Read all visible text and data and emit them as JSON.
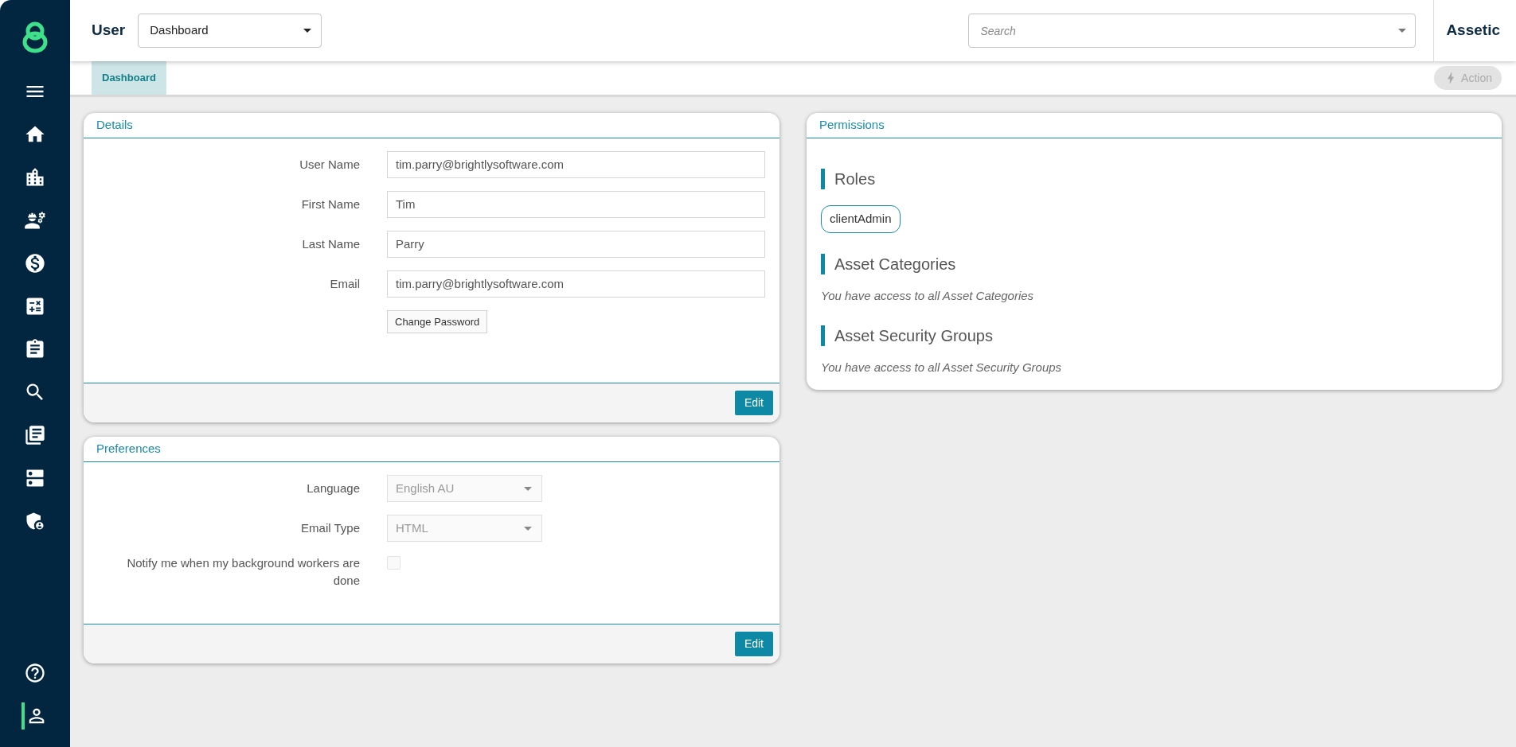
{
  "header": {
    "title": "User",
    "view_select": {
      "value": "Dashboard"
    },
    "search": {
      "placeholder": "Search"
    },
    "brand": "Assetic"
  },
  "tabs": [
    {
      "label": "Dashboard",
      "selected": true
    }
  ],
  "action_button": {
    "label": "Action",
    "disabled": true
  },
  "sidebar": {
    "items": [
      {
        "selected": false
      },
      {
        "selected": false
      },
      {
        "selected": false
      },
      {
        "selected": false
      },
      {
        "selected": false
      },
      {
        "selected": false
      },
      {
        "selected": false
      },
      {
        "selected": false
      },
      {
        "selected": false
      },
      {
        "selected": false
      },
      {
        "selected": false
      }
    ],
    "bottom_items": [
      {
        "selected": false
      },
      {
        "selected": true
      }
    ]
  },
  "details": {
    "title": "Details",
    "fields": [
      {
        "label": "User Name",
        "value": "tim.parry@brightlysoftware.com"
      },
      {
        "label": "First Name",
        "value": "Tim"
      },
      {
        "label": "Last Name",
        "value": "Parry"
      },
      {
        "label": "Email",
        "value": "tim.parry@brightlysoftware.com"
      }
    ],
    "change_password": "Change Password",
    "edit": "Edit"
  },
  "preferences": {
    "title": "Preferences",
    "fields": [
      {
        "kind": "select",
        "label": "Language",
        "value": "English AU",
        "disabled": true
      },
      {
        "kind": "select",
        "label": "Email Type",
        "value": "HTML",
        "disabled": true
      },
      {
        "kind": "checkbox",
        "label": "Notify me when my background workers are done",
        "checked": false,
        "disabled": true
      }
    ],
    "edit": "Edit"
  },
  "permissions": {
    "title": "Permissions",
    "sections": [
      {
        "kind": "tags",
        "heading": "Roles",
        "tags": [
          "clientAdmin"
        ]
      },
      {
        "kind": "note",
        "heading": "Asset Categories",
        "note": "You have access to all Asset Categories"
      },
      {
        "kind": "note",
        "heading": "Asset Security Groups",
        "note": "You have access to all Asset Security Groups"
      }
    ]
  }
}
